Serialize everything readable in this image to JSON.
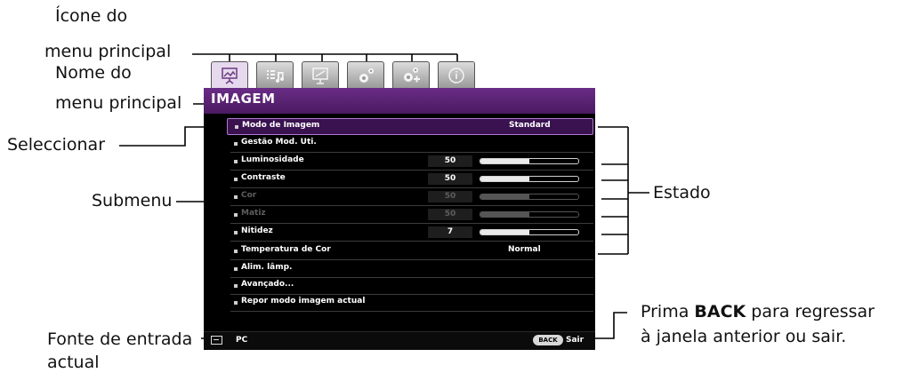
{
  "callouts": {
    "icon_main_menu_1": "Ícone do",
    "icon_main_menu_2": "menu principal",
    "name_main_menu_1": "Nome do",
    "name_main_menu_2": "menu principal",
    "select": "Seleccionar",
    "submenu": "Submenu",
    "status": "Estado",
    "source_1": "Fonte de entrada",
    "source_2": "actual",
    "back_prefix": "Prima ",
    "back_key": "BACK",
    "back_suffix": " para regressar",
    "back_line2": "à janela anterior ou sair."
  },
  "osd": {
    "tabs": [
      {
        "icon": "picture-icon",
        "active": true
      },
      {
        "icon": "audio-settings-icon",
        "active": false
      },
      {
        "icon": "display-icon",
        "active": false
      },
      {
        "icon": "gear-icon",
        "active": false
      },
      {
        "icon": "advanced-gear-icon",
        "active": false
      },
      {
        "icon": "info-icon",
        "active": false
      }
    ],
    "menu_title": "IMAGEM",
    "rows": [
      {
        "label": "Modo de Imagem",
        "value_text": "Standard"
      },
      {
        "label": "Gestão Mod. Uti."
      },
      {
        "label": "Luminosidade",
        "value": "50",
        "level": 0.5
      },
      {
        "label": "Contraste",
        "value": "50",
        "level": 0.5
      },
      {
        "label": "Cor",
        "value": "50",
        "level": 0.5
      },
      {
        "label": "Matiz",
        "value": "50",
        "level": 0.5
      },
      {
        "label": "Nitidez",
        "value": "7",
        "level": 0.5
      },
      {
        "label": "Temperatura de Cor",
        "value_text": "Normal"
      },
      {
        "label": "Alim. lâmp."
      },
      {
        "label": "Avançado..."
      },
      {
        "label": "Repor modo imagem actual"
      }
    ],
    "source": "PC",
    "back_button": "BACK",
    "exit_label": "Sair"
  },
  "colors": {
    "header_purple": "#5a2474",
    "selection_border": "#b07ad0",
    "panel_bg": "#000000"
  }
}
